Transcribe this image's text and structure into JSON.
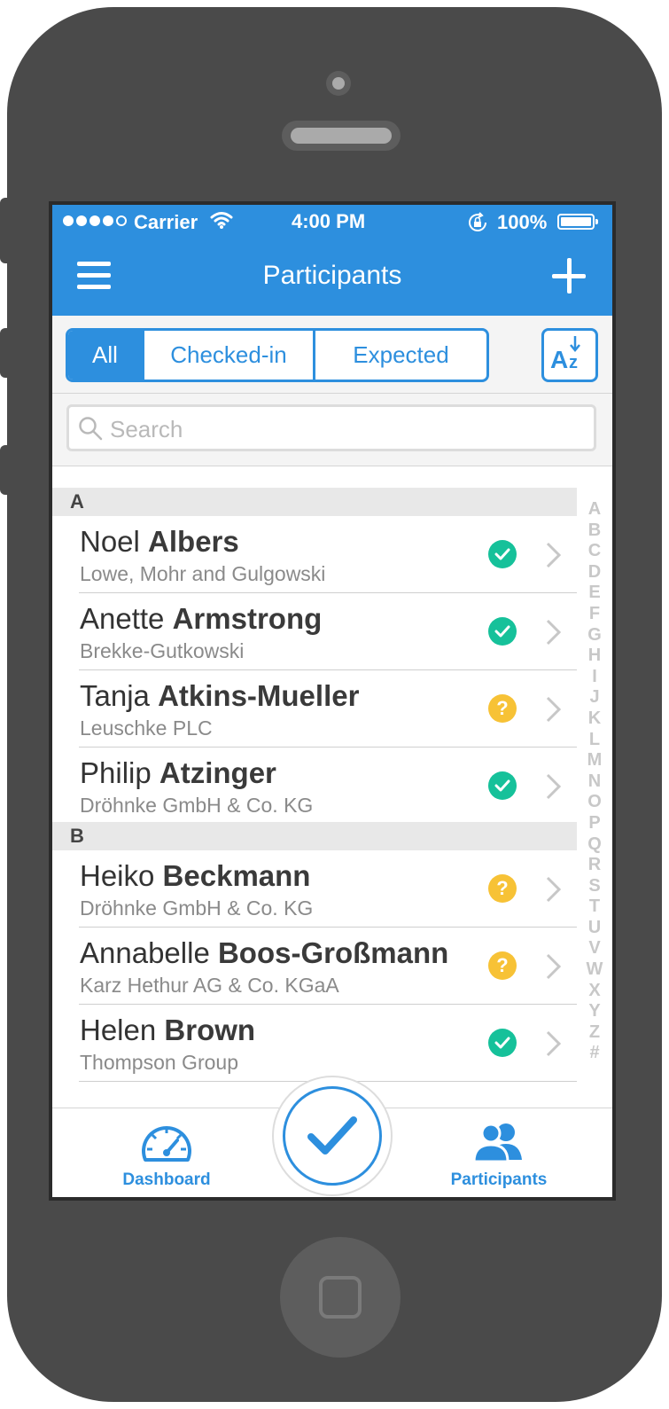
{
  "status_bar": {
    "carrier": "Carrier",
    "time": "4:00 PM",
    "battery": "100%"
  },
  "nav": {
    "title": "Participants"
  },
  "filters": {
    "segments": [
      "All",
      "Checked-in",
      "Expected"
    ],
    "active": "All"
  },
  "search": {
    "placeholder": "Search",
    "value": ""
  },
  "sections": [
    {
      "letter": "A",
      "participants": [
        {
          "first": "Noel",
          "last": "Albers",
          "company": "Lowe, Mohr and Gulgowski",
          "status": "checked-in"
        },
        {
          "first": "Anette",
          "last": "Armstrong",
          "company": "Brekke-Gutkowski",
          "status": "checked-in"
        },
        {
          "first": "Tanja",
          "last": "Atkins-Mueller",
          "company": "Leuschke PLC",
          "status": "expected"
        },
        {
          "first": "Philip",
          "last": "Atzinger",
          "company": "Dröhnke GmbH & Co. KG",
          "status": "checked-in"
        }
      ]
    },
    {
      "letter": "B",
      "participants": [
        {
          "first": "Heiko",
          "last": "Beckmann",
          "company": "Dröhnke GmbH & Co. KG",
          "status": "expected"
        },
        {
          "first": "Annabelle",
          "last": "Boos-Großmann",
          "company": "Karz Hethur AG & Co. KGaA",
          "status": "expected"
        },
        {
          "first": "Helen",
          "last": "Brown",
          "company": "Thompson Group",
          "status": "checked-in"
        }
      ]
    }
  ],
  "index_letters": [
    "A",
    "B",
    "C",
    "D",
    "E",
    "F",
    "G",
    "H",
    "I",
    "J",
    "K",
    "L",
    "M",
    "N",
    "O",
    "P",
    "Q",
    "R",
    "S",
    "T",
    "U",
    "V",
    "W",
    "X",
    "Y",
    "Z",
    "#"
  ],
  "tabbar": {
    "dashboard_label": "Dashboard",
    "participants_label": "Participants"
  },
  "colors": {
    "accent": "#2d8fde",
    "checked_in": "#16c19a",
    "expected": "#f7c236"
  },
  "icons": {
    "menu": "hamburger-icon",
    "add": "plus-icon",
    "sort": "sort-az-icon",
    "search": "magnifier-icon",
    "checked_in": "check-circle-icon",
    "expected": "question-circle-icon",
    "row_disclosure": "chevron-right-icon",
    "dashboard": "speedometer-icon",
    "participants": "people-icon",
    "checkin": "checkmark-icon"
  }
}
